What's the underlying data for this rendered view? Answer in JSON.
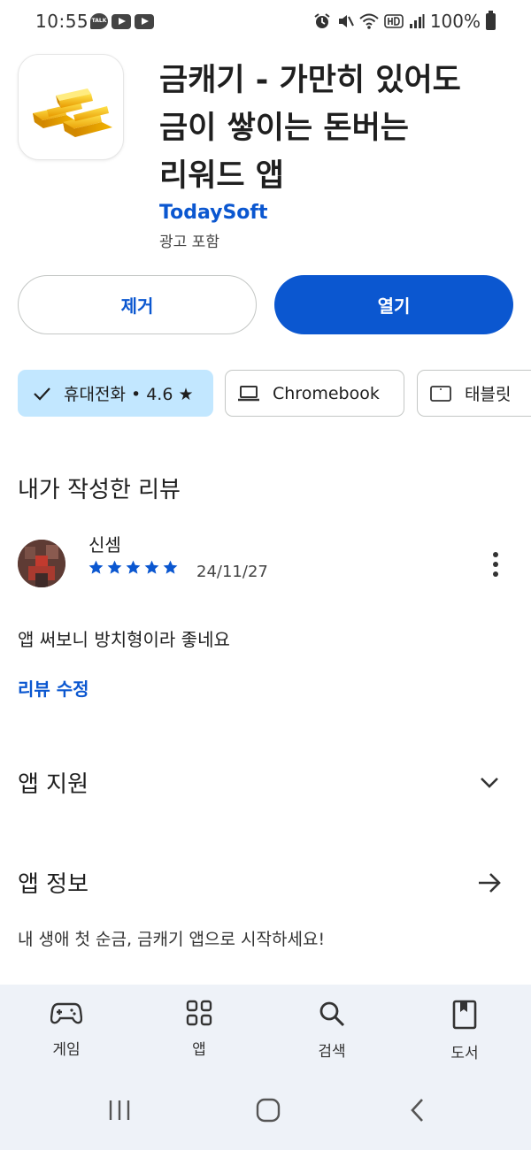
{
  "status_bar": {
    "time": "10:55",
    "talk_badge": "TALK",
    "battery": "100%"
  },
  "app": {
    "title_lines": [
      "금캐기 - 가만히 있어도",
      "금이 쌓이는 돈버는",
      "리워드 앱"
    ],
    "developer": "TodaySoft",
    "ads_note": "광고 포함",
    "icon": "gold-bars-icon"
  },
  "buttons": {
    "remove": "제거",
    "open": "열기"
  },
  "devices": {
    "phone": "휴대전화 • 4.6 ★",
    "chromebook": "Chromebook",
    "tablet": "태블릿"
  },
  "my_review": {
    "section_title": "내가 작성한 리뷰",
    "reviewer": "신셈",
    "rating": 5,
    "date": "24/11/27",
    "text": "앱 써보니 방치형이라 좋네요",
    "edit_label": "리뷰 수정"
  },
  "app_support": {
    "title": "앱 지원"
  },
  "app_info": {
    "title": "앱 정보",
    "description": "내 생애 첫 순금, 금캐기 앱으로 시작하세요!"
  },
  "bottom_nav": {
    "items": [
      {
        "label": "게임",
        "icon": "gamepad-icon"
      },
      {
        "label": "앱",
        "icon": "apps-grid-icon"
      },
      {
        "label": "검색",
        "icon": "search-icon"
      },
      {
        "label": "도서",
        "icon": "book-icon"
      }
    ]
  },
  "colors": {
    "accent": "#0b57d0",
    "chip_selected": "#c2e7ff",
    "star": "#0b57d0",
    "nav_bg": "#eef2f8"
  }
}
